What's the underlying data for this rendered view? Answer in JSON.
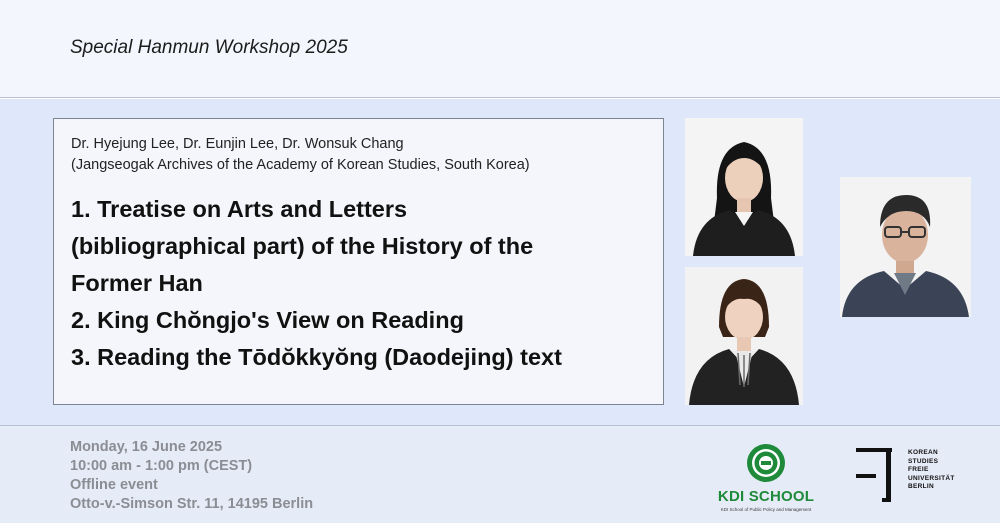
{
  "header": {
    "title": "Special Hanmun Workshop 2025"
  },
  "speakers": {
    "names": "Dr. Hyejung Lee, Dr. Eunjin Lee, Dr. Wonsuk Chang",
    "affiliation": "(Jangseogak Archives of the Academy of Korean Studies, South Korea)"
  },
  "topics": [
    "1. Treatise on Arts and Letters",
    "(bibliographical part) of the History of the",
    "Former Han",
    "2. King Chŏngjo's View on Reading",
    "3. Reading the Tōdŏkkyŏng (Daodejing) text"
  ],
  "photos": [
    {
      "icon": "woman-portrait-icon",
      "background": "#f4f4f4",
      "clothing": "#1e1e1e"
    },
    {
      "icon": "woman-portrait-icon",
      "background": "#f2f2f2",
      "clothing": "#222222"
    },
    {
      "icon": "man-portrait-icon",
      "background": "#f3f3f3",
      "clothing": "#3b4456"
    }
  ],
  "event": {
    "date": "Monday, 16 June 2025",
    "time": "10:00 am - 1:00 pm (CEST)",
    "format": "Offline event",
    "location": "Otto-v.-Simson Str. 11, 14195 Berlin"
  },
  "logos": {
    "kdi": {
      "name": "KDI SCHOOL",
      "subtitle": "KDI School of Public Policy and Management",
      "color": "#1e8a3a"
    },
    "fu": {
      "lines": [
        "KOREAN",
        "STUDIES",
        "FREIE",
        "UNIVERSITÄT",
        "BERLIN"
      ]
    }
  },
  "colors": {
    "header_bg": "#f3f6fc",
    "middle_bg": "#dfe8fa",
    "footer_bg": "#e6ecf7",
    "event_text": "#8a8d93"
  }
}
